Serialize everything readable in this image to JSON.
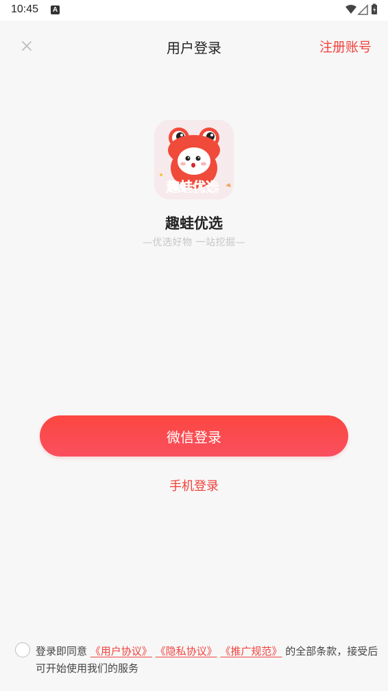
{
  "status_bar": {
    "time": "10:45",
    "notification_icon": "A"
  },
  "header": {
    "title": "用户登录",
    "register_label": "注册账号",
    "close_icon": "close-icon"
  },
  "brand": {
    "app_name": "趣蛙优选",
    "slogan": "—优选好物  一站挖掘—",
    "logo_text": "趣蛙优选"
  },
  "actions": {
    "wechat_login_label": "微信登录",
    "phone_login_label": "手机登录"
  },
  "agreement": {
    "prefix": "登录即同意",
    "user_agreement": "《用户协议》",
    "privacy_agreement": "《隐私协议》",
    "promotion_rules": "《推广规范》",
    "suffix": "的全部条款，接受后可开始使用我们的服务"
  },
  "colors": {
    "accent": "#f2423d",
    "button_gradient_start": "#fb4740",
    "button_gradient_end": "#fa4f5f",
    "background": "#f7f7f7"
  }
}
